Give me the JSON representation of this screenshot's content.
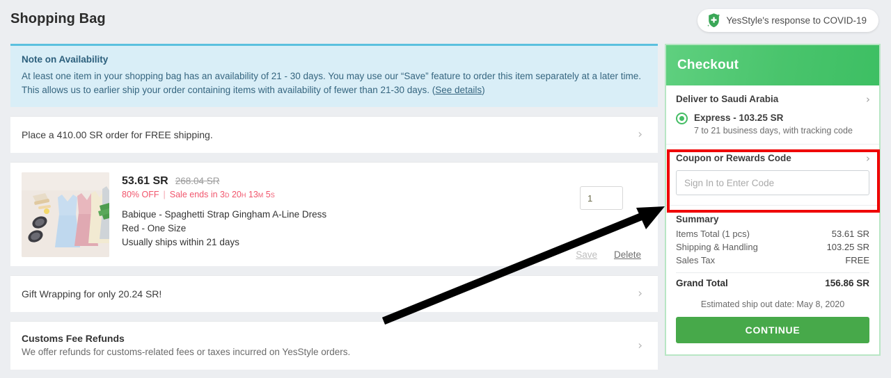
{
  "header": {
    "title": "Shopping Bag",
    "covid_banner": {
      "label": "YesStyle's response to COVID-19",
      "icon": "shield-plus-icon"
    }
  },
  "availability_note": {
    "title": "Note on Availability",
    "line1": "At least one item in your shopping bag has an availability of 21 - 30 days. You may use our “Save” feature to order this item separately at a later time.",
    "line2_pre": "This allows us to earlier ship your order containing items with availability of fewer than 21-30 days. (",
    "link": "See details",
    "line2_post": ")"
  },
  "free_shipping_row": {
    "title": "Place a 410.00 SR order for FREE shipping."
  },
  "product": {
    "price_now": "53.61 SR",
    "price_was": "268.04 SR",
    "discount": "80% OFF",
    "separator": "|",
    "sale_label": "Sale ends in",
    "countdown": {
      "days": "3",
      "days_unit": "D",
      "hours": "20",
      "hours_unit": "H",
      "minutes": "13",
      "minutes_unit": "M",
      "seconds": "5",
      "seconds_unit": "S"
    },
    "name": "Babique - Spaghetti Strap Gingham A-Line Dress",
    "variant": "Red - One Size",
    "shipping_note": "Usually ships within 21 days",
    "quantity": "1",
    "save_label": "Save",
    "delete_label": "Delete"
  },
  "gift_wrapping_row": {
    "title": "Gift Wrapping for only 20.24 SR!"
  },
  "customs_row": {
    "title": "Customs Fee Refunds",
    "subtitle": "We offer refunds for customs-related fees or taxes incurred on YesStyle orders."
  },
  "checkout": {
    "heading": "Checkout",
    "deliver_to": "Deliver to Saudi Arabia",
    "shipping_option": {
      "name": "Express - 103.25 SR",
      "description": "7 to 21 business days, with tracking code",
      "selected": true
    },
    "coupon": {
      "heading": "Coupon or Rewards Code",
      "input_placeholder": "Sign In to Enter Code",
      "input_value": ""
    },
    "summary": {
      "title": "Summary",
      "rows": [
        {
          "label": "Items Total (1 pcs)",
          "value": "53.61 SR"
        },
        {
          "label": "Shipping & Handling",
          "value": "103.25 SR"
        },
        {
          "label": "Sales Tax",
          "value": "FREE"
        }
      ],
      "total_label": "Grand Total",
      "total_value": "156.86 SR"
    },
    "ship_date": "Estimated ship out date: May 8, 2020",
    "continue_label": "CONTINUE"
  },
  "annotations": {
    "highlight_color": "#ef0000",
    "arrow_color": "#000000",
    "arrow_from": "548,463",
    "arrow_to": "955,297"
  },
  "colors": {
    "brand_green": "#45bd65",
    "button_green": "#47a94a",
    "sale_red": "#f1556c",
    "note_blue": "#d9eef7",
    "note_border": "#5bc0de",
    "page_bg": "#eceef1"
  }
}
